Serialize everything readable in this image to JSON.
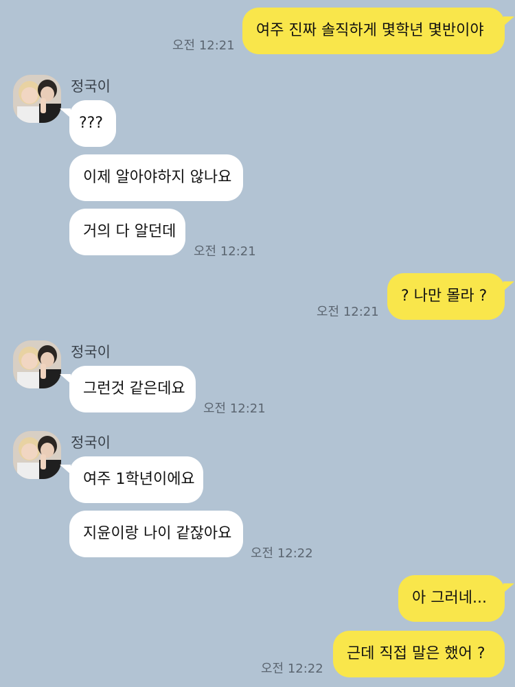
{
  "contact": {
    "name": "정국이"
  },
  "colors": {
    "background": "#b2c3d3",
    "my_bubble": "#f9e64b",
    "their_bubble": "#ffffff"
  },
  "messages": [
    {
      "id": "m1",
      "from": "me",
      "text": "여주 진짜 솔직하게 몇학년 몇반이야",
      "time": "오전 12:21"
    },
    {
      "id": "m2",
      "from": "them",
      "text": "???"
    },
    {
      "id": "m3",
      "from": "them",
      "text": "이제 알아야하지 않나요"
    },
    {
      "id": "m4",
      "from": "them",
      "text": "거의 다 알던데",
      "time": "오전 12:21"
    },
    {
      "id": "m5",
      "from": "me",
      "text": "? 나만 몰라 ?",
      "time": "오전 12:21"
    },
    {
      "id": "m6",
      "from": "them",
      "text": "그런것 같은데요",
      "time": "오전 12:21"
    },
    {
      "id": "m7",
      "from": "them",
      "text": "여주 1학년이에요"
    },
    {
      "id": "m8",
      "from": "them",
      "text": "지윤이랑 나이 같잖아요",
      "time": "오전 12:22"
    },
    {
      "id": "m9",
      "from": "me",
      "text": "아 그러네..."
    },
    {
      "id": "m10",
      "from": "me",
      "text": "근데 직접 말은 했어 ?",
      "time": "오전 12:22"
    }
  ]
}
